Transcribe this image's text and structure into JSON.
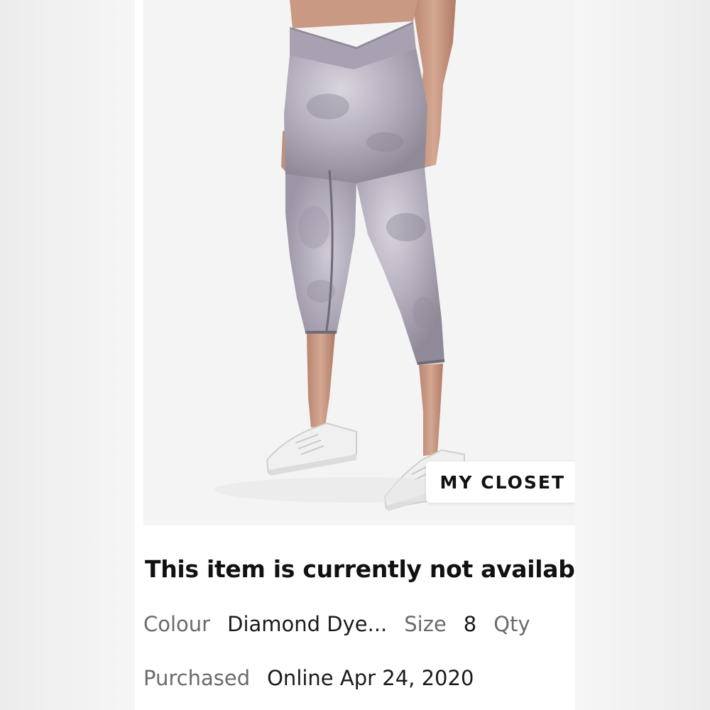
{
  "badge": {
    "label": "MY CLOSET"
  },
  "item": {
    "status": "This item is currently not available",
    "colour_label": "Colour",
    "colour_value": "Diamond Dye...",
    "size_label": "Size",
    "size_value": "8",
    "qty_label": "Qty",
    "purchased_label": "Purchased",
    "purchased_value": "Online Apr 24, 2020"
  },
  "colors": {
    "page_bg": "#f3f3f3",
    "card_bg": "#ffffff",
    "photo_bg": "#f4f4f4",
    "leggings": "#b8b3c0",
    "leggings_dark": "#8f8998",
    "skin": "#c89882",
    "sneakers": "#f2f2f2",
    "label_text": "#6b6b6b",
    "value_text": "#1a1a1a"
  },
  "icons": {
    "badge": "none"
  }
}
